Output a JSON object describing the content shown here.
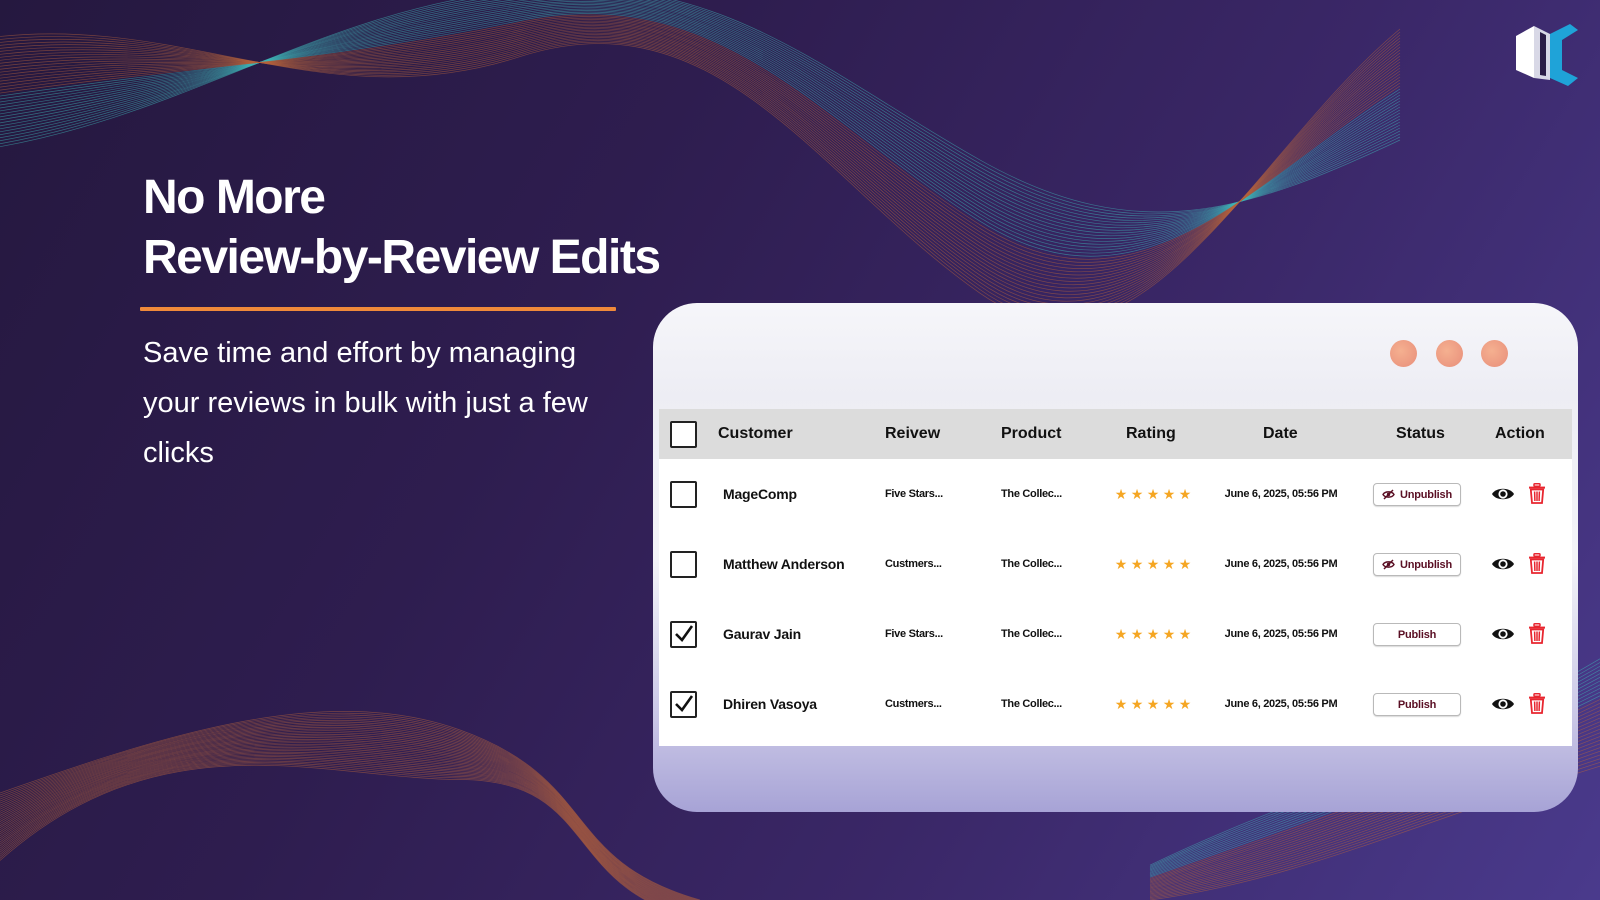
{
  "slide": {
    "headline_line1": "No More",
    "headline_line2": "Review-by-Review Edits",
    "subtext": "Save time and effort by managing your reviews in bulk with just a few clicks",
    "accent_color": "#f08a3a"
  },
  "logo": {
    "icon": "magecomp-logo",
    "colors": [
      "#ffffff",
      "#1fa3d8"
    ]
  },
  "window": {
    "controls": [
      "window-dot-icon",
      "window-dot-icon",
      "window-dot-icon"
    ],
    "table": {
      "columns": {
        "customer": "Customer",
        "review": "Reivew",
        "product": "Product",
        "rating": "Rating",
        "date": "Date",
        "status": "Status",
        "action": "Action"
      },
      "select_all_checked": false,
      "rows": [
        {
          "checked": false,
          "customer": "MageComp",
          "review": "Five Stars...",
          "product": "The Collec...",
          "rating": 5,
          "date": "June 6, 2025, 05:56 PM",
          "status": "Unpublish",
          "status_icon": "eye-slash-icon"
        },
        {
          "checked": false,
          "customer": "Matthew Anderson",
          "review": "Custmers...",
          "product": "The Collec...",
          "rating": 5,
          "date": "June 6, 2025, 05:56 PM",
          "status": "Unpublish",
          "status_icon": "eye-slash-icon"
        },
        {
          "checked": true,
          "customer": "Gaurav Jain",
          "review": "Five Stars...",
          "product": "The Collec...",
          "rating": 5,
          "date": "June 6, 2025, 05:56 PM",
          "status": "Publish",
          "status_icon": ""
        },
        {
          "checked": true,
          "customer": "Dhiren Vasoya",
          "review": "Custmers...",
          "product": "The Collec...",
          "rating": 5,
          "date": "June 6, 2025, 05:56 PM",
          "status": "Publish",
          "status_icon": ""
        }
      ],
      "star_color": "#f5a623",
      "delete_color": "#e8262f",
      "status_text_color": "#5a0f24"
    }
  }
}
